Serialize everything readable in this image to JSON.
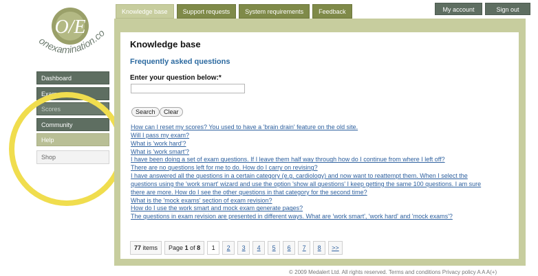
{
  "logo": {
    "monogram": "O/E",
    "wordmark": "onexamination.com"
  },
  "tabs": [
    {
      "label": "Knowledge base"
    },
    {
      "label": "Support requests"
    },
    {
      "label": "System requirements"
    },
    {
      "label": "Feedback"
    }
  ],
  "account": {
    "my_account": "My account",
    "sign_out": "Sign out"
  },
  "sidebar": {
    "items": [
      {
        "label": "Dashboard"
      },
      {
        "label": "Exams"
      },
      {
        "label": "Scores"
      },
      {
        "label": "Community"
      },
      {
        "label": "Help"
      },
      {
        "label": "Shop"
      }
    ]
  },
  "main": {
    "title": "Knowledge base",
    "faq_title": "Frequently asked questions",
    "question_label": "Enter your question below:*",
    "question_value": "",
    "search_label": "Search",
    "clear_label": "Clear",
    "questions": [
      "How can I reset my scores? You used to have a 'brain drain' feature on the old site.",
      "Will I pass my exam?",
      "What is 'work hard'?",
      "What is 'work smart'?",
      "I have been doing a set of exam questions. If I leave them half way through how do I continue from where I left off?",
      "There are no questions left for me to do. How do I carry on revising?",
      "I have answered all the questions in a certain category (e.g. cardiology) and now want to reattempt them. When I select the",
      "questions using the 'work smart' wizard and use the option 'show all questions' I keep getting the same 100 questions. I am sure",
      "there are more. How do I see the other questions in that category for the second time?",
      "What is the 'mock exams' section of exam revision?",
      "How do I use the work smart and mock exam generate pages?",
      "The questions in exam revision are presented in different ways. What are 'work smart', 'work hard' and 'mock exams'?"
    ]
  },
  "pagination": {
    "items_count": "77",
    "items_label": "items",
    "page_prefix": "Page",
    "current_page": "1",
    "of_label": "of",
    "total_pages": "8",
    "pages": [
      "1",
      "2",
      "3",
      "4",
      "5",
      "6",
      "7",
      "8"
    ],
    "next_label": ">>"
  },
  "footer": {
    "text": "© 2009 Medalert Ltd. All rights reserved.  Terms and conditions  Privacy policy  A A A(+)"
  },
  "colors": {
    "nav_green": "#5e6e61",
    "tab_olive": "#7f8a49",
    "panel_sage": "#c7cd9e",
    "link_blue": "#2c5f9e",
    "highlight_yellow": "#f0dd4e"
  }
}
